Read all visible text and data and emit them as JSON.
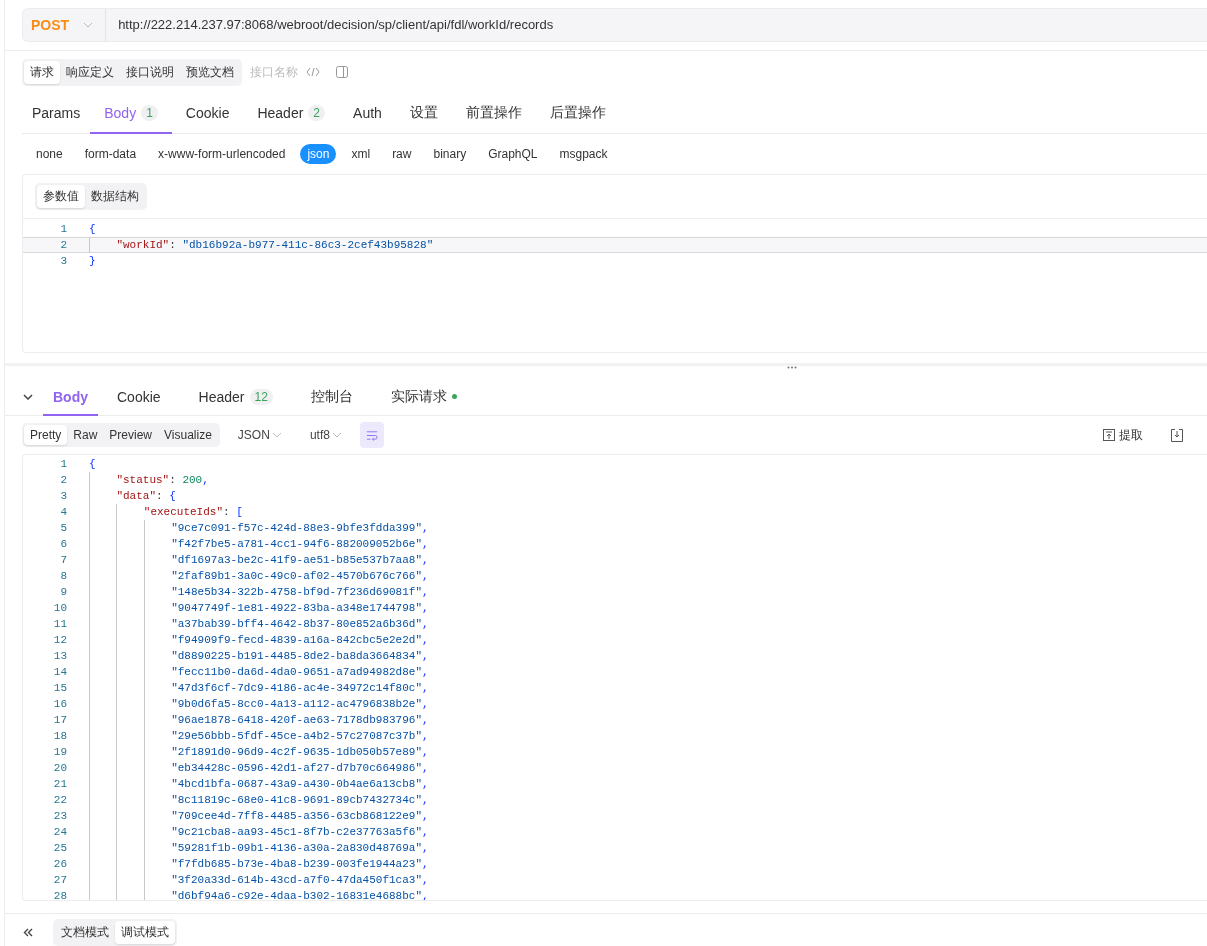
{
  "request": {
    "method": "POST",
    "url": "http://222.214.237.97:8068/webroot/decision/sp/client/api/fdl/workId/records"
  },
  "doc_tabs": [
    {
      "label": "请求",
      "selected": true
    },
    {
      "label": "响应定义",
      "selected": false
    },
    {
      "label": "接口说明",
      "selected": false
    },
    {
      "label": "预览文档",
      "selected": false
    }
  ],
  "interface_name": {
    "placeholder": "接口名称"
  },
  "request_tabs": [
    {
      "label": "Params",
      "selected": false
    },
    {
      "label": "Body",
      "badge": "1",
      "selected": true
    },
    {
      "label": "Cookie",
      "selected": false
    },
    {
      "label": "Header",
      "badge": "2",
      "selected": false
    },
    {
      "label": "Auth",
      "selected": false
    },
    {
      "label": "设置",
      "selected": false
    },
    {
      "label": "前置操作",
      "selected": false
    },
    {
      "label": "后置操作",
      "selected": false
    }
  ],
  "body_types": [
    {
      "label": "none",
      "selected": false
    },
    {
      "label": "form-data",
      "selected": false
    },
    {
      "label": "x-www-form-urlencoded",
      "selected": false
    },
    {
      "label": "json",
      "selected": true
    },
    {
      "label": "xml",
      "selected": false
    },
    {
      "label": "raw",
      "selected": false
    },
    {
      "label": "binary",
      "selected": false
    },
    {
      "label": "GraphQL",
      "selected": false
    },
    {
      "label": "msgpack",
      "selected": false
    }
  ],
  "editor_tabs": [
    {
      "label": "参数值",
      "selected": true
    },
    {
      "label": "数据结构",
      "selected": false
    }
  ],
  "request_code": [
    {
      "number": "1",
      "text": "{",
      "active": false
    },
    {
      "number": "2",
      "text": "    \"workId\": \"db16b92a-b977-411c-86c3-2cef43b95828\"",
      "active": true
    },
    {
      "number": "3",
      "text": "}",
      "active": false
    }
  ],
  "response_tabs": [
    {
      "label": "Body",
      "selected": true,
      "status_dot": false
    },
    {
      "label": "Cookie",
      "selected": false,
      "status_dot": false
    },
    {
      "label": "Header",
      "badge": "12",
      "selected": false,
      "status_dot": false
    },
    {
      "label": "控制台",
      "selected": false,
      "status_dot": false
    },
    {
      "label": "实际请求",
      "selected": false,
      "status_dot": true
    }
  ],
  "view_tabs": [
    {
      "label": "Pretty",
      "selected": true
    },
    {
      "label": "Raw",
      "selected": false
    },
    {
      "label": "Preview",
      "selected": false
    },
    {
      "label": "Visualize",
      "selected": false
    }
  ],
  "format": "JSON",
  "encoding": "utf8",
  "word_wrap": true,
  "extract_label": "提取",
  "response_code": [
    {
      "number": "1",
      "text": "{"
    },
    {
      "number": "2",
      "text": "    \"status\": 200,"
    },
    {
      "number": "3",
      "text": "    \"data\": {"
    },
    {
      "number": "4",
      "text": "        \"executeIds\": ["
    },
    {
      "number": "5",
      "text": "            \"9ce7c091-f57c-424d-88e3-9bfe3fdda399\","
    },
    {
      "number": "6",
      "text": "            \"f42f7be5-a781-4cc1-94f6-882009052b6e\","
    },
    {
      "number": "7",
      "text": "            \"df1697a3-be2c-41f9-ae51-b85e537b7aa8\","
    },
    {
      "number": "8",
      "text": "            \"2faf89b1-3a0c-49c0-af02-4570b676c766\","
    },
    {
      "number": "9",
      "text": "            \"148e5b34-322b-4758-bf9d-7f236d69081f\","
    },
    {
      "number": "10",
      "text": "            \"9047749f-1e81-4922-83ba-a348e1744798\","
    },
    {
      "number": "11",
      "text": "            \"a37bab39-bff4-4642-8b37-80e852a6b36d\","
    },
    {
      "number": "12",
      "text": "            \"f94909f9-fecd-4839-a16a-842cbc5e2e2d\","
    },
    {
      "number": "13",
      "text": "            \"d8890225-b191-4485-8de2-ba8da3664834\","
    },
    {
      "number": "14",
      "text": "            \"fecc11b0-da6d-4da0-9651-a7ad94982d8e\","
    },
    {
      "number": "15",
      "text": "            \"47d3f6cf-7dc9-4186-ac4e-34972c14f80c\","
    },
    {
      "number": "16",
      "text": "            \"9b0d6fa5-8cc0-4a13-a112-ac4796838b2e\","
    },
    {
      "number": "17",
      "text": "            \"96ae1878-6418-420f-ae63-7178db983796\","
    },
    {
      "number": "18",
      "text": "            \"29e56bbb-5fdf-45ce-a4b2-57c27087c37b\","
    },
    {
      "number": "19",
      "text": "            \"2f1891d0-96d9-4c2f-9635-1db050b57e89\","
    },
    {
      "number": "20",
      "text": "            \"eb34428c-0596-42d1-af27-d7b70c664986\","
    },
    {
      "number": "21",
      "text": "            \"4bcd1bfa-0687-43a9-a430-0b4ae6a13cb8\","
    },
    {
      "number": "22",
      "text": "            \"8c11819c-68e0-41c8-9691-89cb7432734c\","
    },
    {
      "number": "23",
      "text": "            \"709cee4d-7ff8-4485-a356-63cb868122e9\","
    },
    {
      "number": "24",
      "text": "            \"9c21cba8-aa93-45c1-8f7b-c2e37763a5f6\","
    },
    {
      "number": "25",
      "text": "            \"59281f1b-09b1-4136-a30a-2a830d48769a\","
    },
    {
      "number": "26",
      "text": "            \"f7fdb685-b73e-4ba8-b239-003fe1944a23\","
    },
    {
      "number": "27",
      "text": "            \"3f20a33d-614b-43cd-a7f0-47da450f1ca3\","
    },
    {
      "number": "28",
      "text": "            \"d6bf94a6-c92e-4daa-b302-16831e4688bc\","
    }
  ],
  "mode_tabs": [
    {
      "label": "文档模式",
      "selected": false
    },
    {
      "label": "调试模式",
      "selected": true
    }
  ]
}
